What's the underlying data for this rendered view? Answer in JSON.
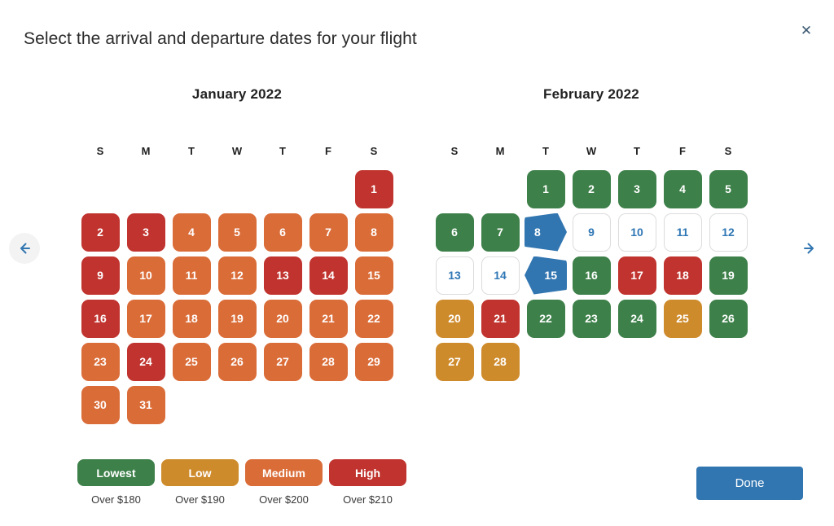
{
  "dialog": {
    "title": "Select the arrival and departure dates for your flight",
    "close_icon": "close-icon"
  },
  "nav": {
    "prev_label": "←",
    "next_label": "→"
  },
  "weekdays": [
    "S",
    "M",
    "T",
    "W",
    "T",
    "F",
    "S"
  ],
  "months": [
    {
      "title": "January 2022",
      "weeks": [
        [
          null,
          null,
          null,
          null,
          null,
          null,
          {
            "day": "1",
            "price": "high"
          }
        ],
        [
          {
            "day": "2",
            "price": "high"
          },
          {
            "day": "3",
            "price": "high"
          },
          {
            "day": "4",
            "price": "medium"
          },
          {
            "day": "5",
            "price": "medium"
          },
          {
            "day": "6",
            "price": "medium"
          },
          {
            "day": "7",
            "price": "medium"
          },
          {
            "day": "8",
            "price": "medium"
          }
        ],
        [
          {
            "day": "9",
            "price": "high"
          },
          {
            "day": "10",
            "price": "medium"
          },
          {
            "day": "11",
            "price": "medium"
          },
          {
            "day": "12",
            "price": "medium"
          },
          {
            "day": "13",
            "price": "high"
          },
          {
            "day": "14",
            "price": "high"
          },
          {
            "day": "15",
            "price": "medium"
          }
        ],
        [
          {
            "day": "16",
            "price": "high"
          },
          {
            "day": "17",
            "price": "medium"
          },
          {
            "day": "18",
            "price": "medium"
          },
          {
            "day": "19",
            "price": "medium"
          },
          {
            "day": "20",
            "price": "medium"
          },
          {
            "day": "21",
            "price": "medium"
          },
          {
            "day": "22",
            "price": "medium"
          }
        ],
        [
          {
            "day": "23",
            "price": "medium"
          },
          {
            "day": "24",
            "price": "high"
          },
          {
            "day": "25",
            "price": "medium"
          },
          {
            "day": "26",
            "price": "medium"
          },
          {
            "day": "27",
            "price": "medium"
          },
          {
            "day": "28",
            "price": "medium"
          },
          {
            "day": "29",
            "price": "medium"
          }
        ],
        [
          {
            "day": "30",
            "price": "medium"
          },
          {
            "day": "31",
            "price": "medium"
          },
          null,
          null,
          null,
          null,
          null
        ]
      ]
    },
    {
      "title": "February 2022",
      "weeks": [
        [
          null,
          null,
          {
            "day": "1",
            "price": "lowest"
          },
          {
            "day": "2",
            "price": "lowest"
          },
          {
            "day": "3",
            "price": "lowest"
          },
          {
            "day": "4",
            "price": "lowest"
          },
          {
            "day": "5",
            "price": "lowest"
          }
        ],
        [
          {
            "day": "6",
            "price": "lowest"
          },
          {
            "day": "7",
            "price": "lowest"
          },
          {
            "day": "8",
            "price": "lowest",
            "state": "selected-start"
          },
          {
            "day": "9",
            "price": "lowest",
            "state": "in-range"
          },
          {
            "day": "10",
            "price": "lowest",
            "state": "in-range"
          },
          {
            "day": "11",
            "price": "lowest",
            "state": "in-range"
          },
          {
            "day": "12",
            "price": "lowest",
            "state": "in-range"
          }
        ],
        [
          {
            "day": "13",
            "price": "lowest",
            "state": "in-range"
          },
          {
            "day": "14",
            "price": "lowest",
            "state": "in-range"
          },
          {
            "day": "15",
            "price": "lowest",
            "state": "selected-end"
          },
          {
            "day": "16",
            "price": "lowest"
          },
          {
            "day": "17",
            "price": "high"
          },
          {
            "day": "18",
            "price": "high"
          },
          {
            "day": "19",
            "price": "lowest"
          }
        ],
        [
          {
            "day": "20",
            "price": "low"
          },
          {
            "day": "21",
            "price": "high"
          },
          {
            "day": "22",
            "price": "lowest"
          },
          {
            "day": "23",
            "price": "lowest"
          },
          {
            "day": "24",
            "price": "lowest"
          },
          {
            "day": "25",
            "price": "low"
          },
          {
            "day": "26",
            "price": "lowest"
          }
        ],
        [
          {
            "day": "27",
            "price": "low"
          },
          {
            "day": "28",
            "price": "low"
          },
          null,
          null,
          null,
          null,
          null
        ]
      ]
    }
  ],
  "legend": [
    {
      "label": "Lowest",
      "caption": "Over $180",
      "key": "lowest",
      "color": "#3d8049"
    },
    {
      "label": "Low",
      "caption": "Over $190",
      "key": "low",
      "color": "#ce8b2c"
    },
    {
      "label": "Medium",
      "caption": "Over $200",
      "key": "medium",
      "color": "#da6c38"
    },
    {
      "label": "High",
      "caption": "Over $210",
      "key": "high",
      "color": "#c0332e"
    }
  ],
  "footer": {
    "done_label": "Done"
  },
  "colors": {
    "accent_blue": "#3276b1",
    "selected_text": "#2f77b5",
    "lowest": "#3d8049",
    "low": "#ce8b2c",
    "medium": "#da6c38",
    "high": "#c0332e"
  }
}
